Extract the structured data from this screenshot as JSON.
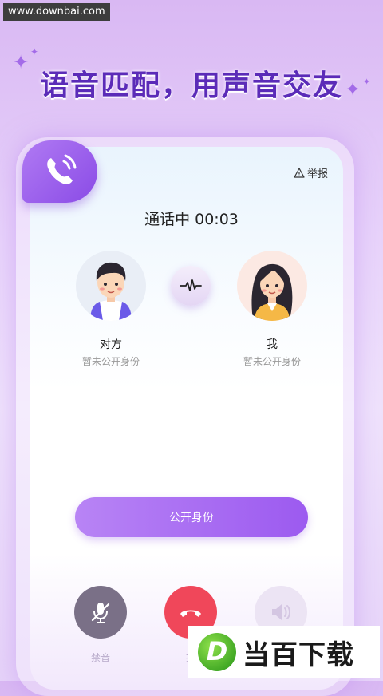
{
  "watermark_top": "www.downbai.com",
  "headline": "语音匹配，用声音交友",
  "report_label": "举报",
  "call_status": "通话中 00:03",
  "peer": {
    "name": "对方",
    "identity": "暂未公开身份"
  },
  "me": {
    "name": "我",
    "identity": "暂未公开身份"
  },
  "reveal_button": "公开身份",
  "controls": {
    "mute_label": "禁音",
    "hangup_label": "挂"
  },
  "watermark_bottom": {
    "logo_letter": "D",
    "text": "当百下载"
  },
  "colors": {
    "accent": "#9c5af0",
    "hangup": "#f0475a",
    "headline": "#5b2bb8"
  },
  "icons": [
    "phone-waves-icon",
    "warning-icon",
    "waveform-icon",
    "mic-off-icon",
    "hangup-icon",
    "speaker-icon"
  ]
}
